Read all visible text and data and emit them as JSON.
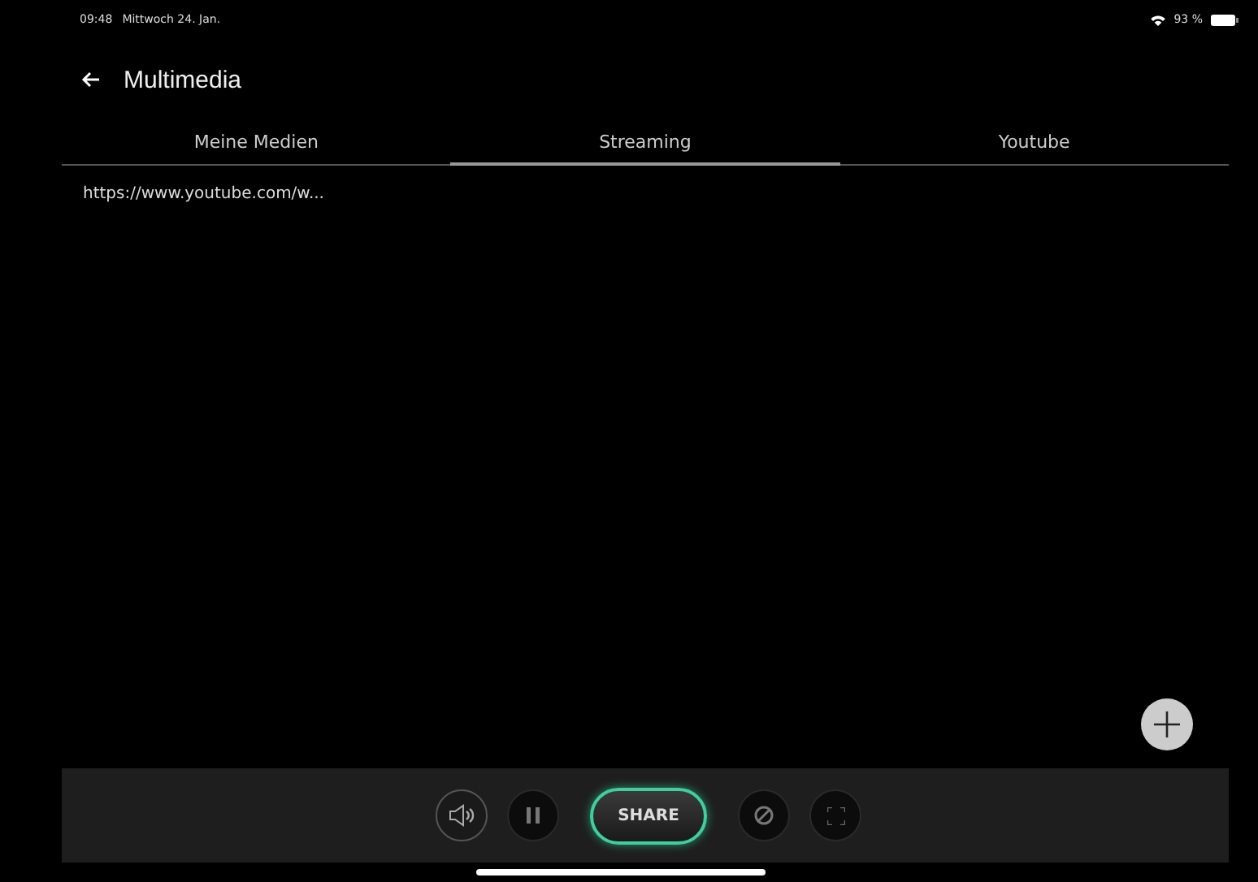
{
  "status_bar": {
    "time": "09:48",
    "date": "Mittwoch 24. Jan.",
    "battery": "93 %"
  },
  "header": {
    "title": "Multimedia"
  },
  "tabs": [
    {
      "label": "Meine Medien",
      "selected": false
    },
    {
      "label": "Streaming",
      "selected": true
    },
    {
      "label": "Youtube",
      "selected": false
    }
  ],
  "items": [
    {
      "url": "https://www.youtube.com/w..."
    }
  ],
  "controls": {
    "share_label": "SHARE"
  }
}
